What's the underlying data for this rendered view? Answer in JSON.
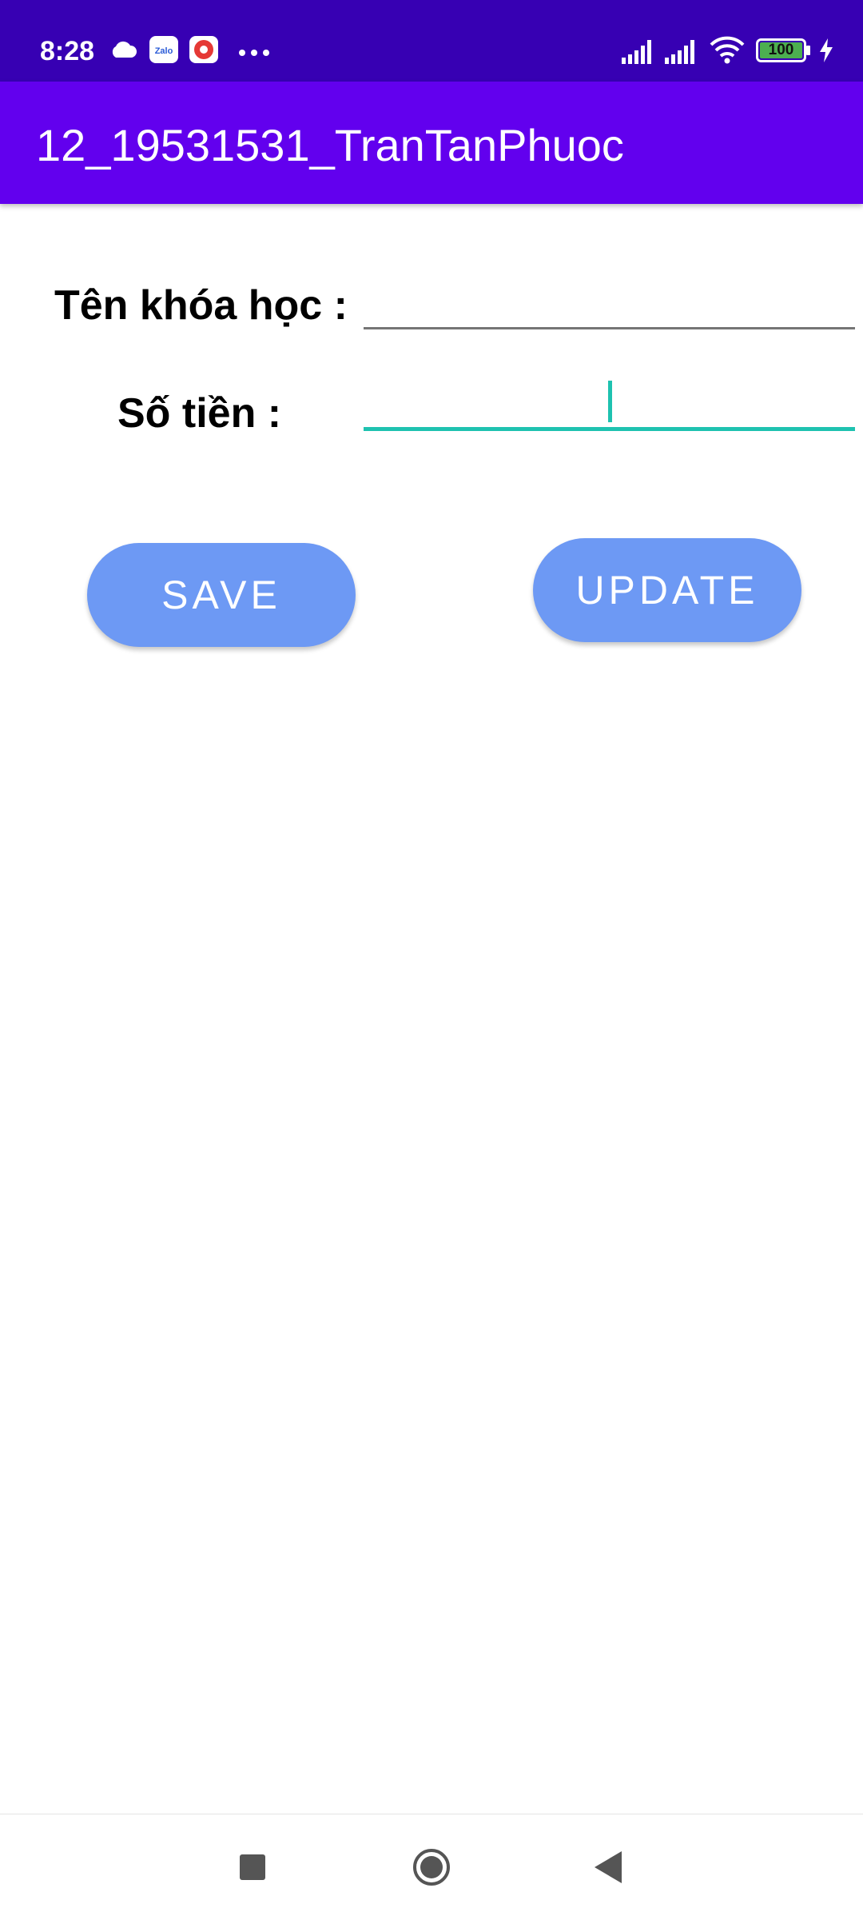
{
  "status_bar": {
    "time": "8:28",
    "battery": "100",
    "icons": [
      "cloud-icon",
      "zalo-icon",
      "notification-app-icon",
      "more-dots-icon",
      "signal-icon",
      "signal-icon",
      "wifi-icon",
      "battery-icon",
      "charging-icon"
    ],
    "zalo_label": "Zalo"
  },
  "app_bar": {
    "title": "12_19531531_TranTanPhuoc",
    "background": "#6200ee"
  },
  "form": {
    "course_label": "Tên khóa học :",
    "course_value": "",
    "amount_label": "Số tiền :",
    "amount_value": ""
  },
  "buttons": {
    "save_label": "SAVE",
    "update_label": "UPDATE",
    "color": "#6d99f4"
  },
  "nav_bar": {
    "icons": [
      "recents-square-icon",
      "home-circle-icon",
      "back-triangle-icon"
    ]
  }
}
